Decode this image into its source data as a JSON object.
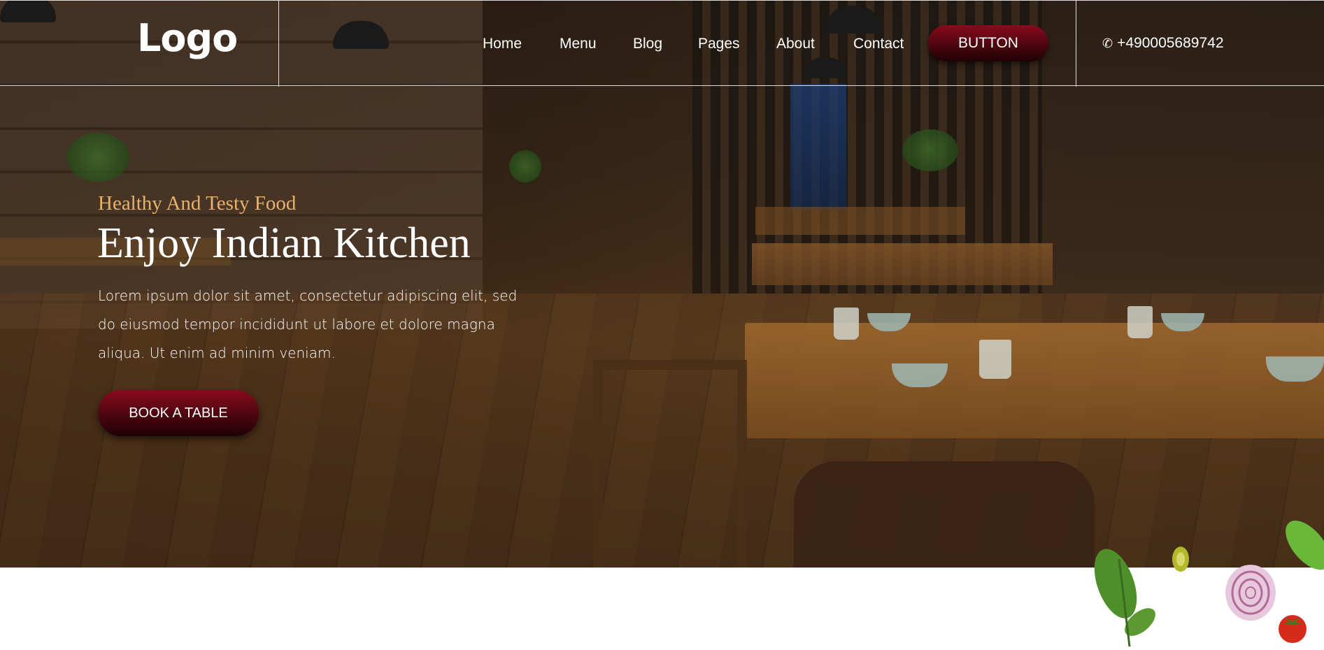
{
  "header": {
    "logo": "Logo",
    "nav": [
      {
        "label": "Home"
      },
      {
        "label": "Menu"
      },
      {
        "label": "Blog"
      },
      {
        "label": "Pages"
      },
      {
        "label": "About"
      },
      {
        "label": "Contact"
      }
    ],
    "button_label": "BUTTON",
    "phone_icon": "phone-icon",
    "phone": "+490005689742"
  },
  "hero": {
    "tagline": "Healthy And Testy Food",
    "title": "Enjoy Indian Kitchen",
    "description": "Lorem ipsum dolor sit amet, consectetur adipiscing elit, sed do eiusmod tempor incididunt ut labore et dolore magna aliqua. Ut enim ad minim veniam.",
    "cta_label": "BOOK A TABLE"
  },
  "colors": {
    "accent": "#6b0a16",
    "tagline": "#e9b26a",
    "text": "#ffffff"
  }
}
